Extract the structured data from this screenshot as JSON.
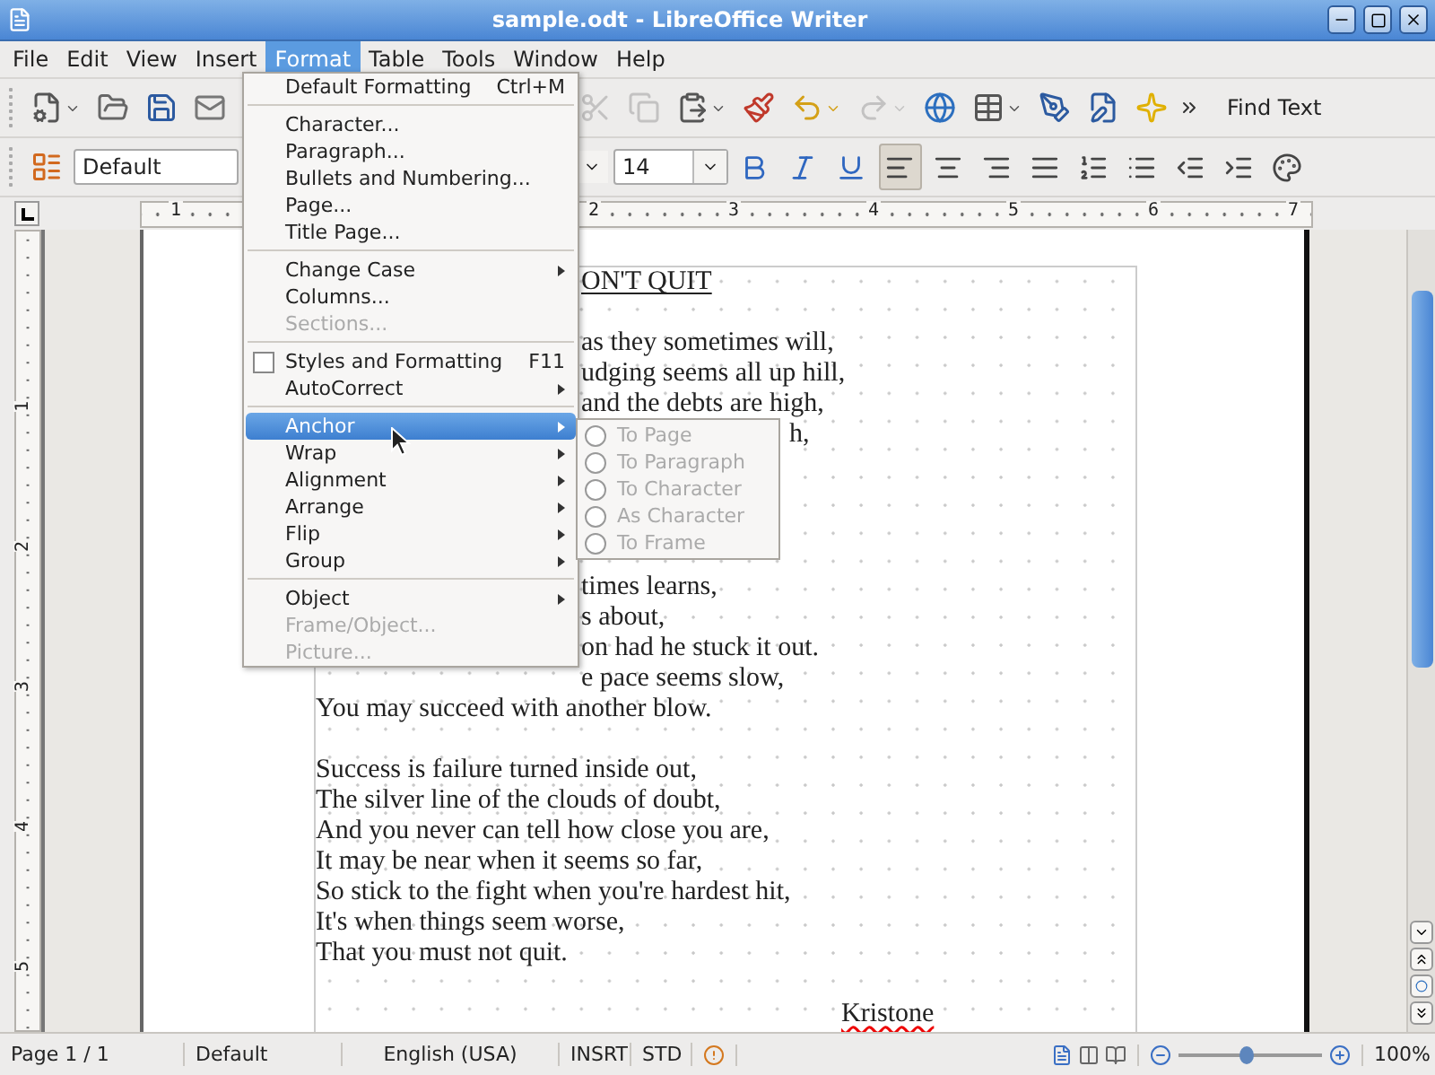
{
  "window": {
    "title": "sample.odt - LibreOffice Writer"
  },
  "menu_bar": [
    {
      "label": "File",
      "selected": false
    },
    {
      "label": "Edit",
      "selected": false
    },
    {
      "label": "View",
      "selected": false
    },
    {
      "label": "Insert",
      "selected": false
    },
    {
      "label": "Format",
      "selected": true
    },
    {
      "label": "Table",
      "selected": false
    },
    {
      "label": "Tools",
      "selected": false
    },
    {
      "label": "Window",
      "selected": false
    },
    {
      "label": "Help",
      "selected": false
    }
  ],
  "toolbar_standard": {
    "buttons": [
      {
        "dropdown": true,
        "disabled": false
      },
      {
        "dropdown": false,
        "disabled": false
      },
      {
        "dropdown": false,
        "disabled": false
      },
      {
        "dropdown": false,
        "disabled": false
      },
      {
        "dropdown": false,
        "disabled": true
      },
      {
        "dropdown": false,
        "disabled": true
      },
      {
        "dropdown": true,
        "disabled": false
      },
      {
        "dropdown": false,
        "disabled": false
      },
      {
        "dropdown": true,
        "disabled": false
      },
      {
        "dropdown": true,
        "disabled": true
      },
      {
        "dropdown": false,
        "disabled": false
      },
      {
        "dropdown": true,
        "disabled": false
      },
      {
        "dropdown": false,
        "disabled": false
      },
      {
        "dropdown": false,
        "disabled": false
      },
      {
        "dropdown": false,
        "disabled": false
      }
    ],
    "find_text": "Find Text"
  },
  "toolbar_formatting": {
    "paragraph_style": "Default",
    "font_size": "14",
    "buttons": [
      {
        "selected": false
      },
      {
        "selected": false
      },
      {
        "selected": false
      },
      {
        "selected": true
      },
      {
        "selected": false
      },
      {
        "selected": false
      },
      {
        "selected": false
      },
      {
        "selected": false
      },
      {
        "selected": false
      },
      {
        "selected": false
      },
      {
        "selected": false
      },
      {
        "selected": false
      }
    ]
  },
  "ruler": {
    "left_marks": [
      "1"
    ],
    "marks": [
      "2",
      "3",
      "4",
      "5",
      "6",
      "7"
    ]
  },
  "vertical_ruler": {
    "marks": [
      "1",
      "2",
      "3",
      "4",
      "5"
    ]
  },
  "document": {
    "stanzas": [
      {
        "kind": "title",
        "lines": [
          {
            "text": "ON'T QUIT",
            "clipped": true,
            "beside_submenu": false
          }
        ]
      },
      {
        "kind": "verse",
        "lines": [
          {
            "text": "as they sometimes will,",
            "clipped": true,
            "beside_submenu": false
          },
          {
            "text": "udging seems all up hill,",
            "clipped": true,
            "beside_submenu": false
          },
          {
            "text": "and the debts are high,",
            "clipped": true,
            "beside_submenu": false
          },
          {
            "text": "h,",
            "clipped": true,
            "beside_submenu": true
          },
          {
            "text": "times learns,",
            "clipped": true,
            "beside_submenu": false
          },
          {
            "text": "s about,",
            "clipped": true,
            "beside_submenu": false
          },
          {
            "text": "on had he stuck it out.",
            "clipped": true,
            "beside_submenu": false
          },
          {
            "text": "e pace seems slow,",
            "clipped": true,
            "beside_submenu": false
          },
          {
            "text": "You may succeed with another blow.",
            "clipped": false,
            "beside_submenu": false
          }
        ]
      },
      {
        "kind": "verse",
        "lines": [
          {
            "text": "Success is failure turned inside out,",
            "clipped": false,
            "beside_submenu": false
          },
          {
            "text": "The silver line of the clouds of doubt,",
            "clipped": false,
            "beside_submenu": false
          },
          {
            "text": "And you never can tell how close you are,",
            "clipped": false,
            "beside_submenu": false
          },
          {
            "text": "It may be near when it seems so far,",
            "clipped": false,
            "beside_submenu": false
          },
          {
            "text": "So stick to the fight when you're hardest hit,",
            "clipped": false,
            "beside_submenu": false
          },
          {
            "text": "It's when things seem worse,",
            "clipped": false,
            "beside_submenu": false
          },
          {
            "text": "That you must not quit.",
            "clipped": false,
            "beside_submenu": false
          }
        ]
      },
      {
        "kind": "signature",
        "lines": [
          {
            "text": "Kristone",
            "misspelled": true
          }
        ]
      }
    ]
  },
  "format_menu": {
    "items": [
      {
        "kind": "item",
        "label": "Default Formatting",
        "shortcut": "Ctrl+M",
        "disabled": false,
        "submenu": false,
        "selected": false
      },
      {
        "kind": "separator"
      },
      {
        "kind": "item",
        "label": "Character...",
        "disabled": false,
        "submenu": false,
        "selected": false
      },
      {
        "kind": "item",
        "label": "Paragraph...",
        "disabled": false,
        "submenu": false,
        "selected": false
      },
      {
        "kind": "item",
        "label": "Bullets and Numbering...",
        "disabled": false,
        "submenu": false,
        "selected": false
      },
      {
        "kind": "item",
        "label": "Page...",
        "disabled": false,
        "submenu": false,
        "selected": false
      },
      {
        "kind": "item",
        "label": "Title Page...",
        "disabled": false,
        "submenu": false,
        "selected": false
      },
      {
        "kind": "separator"
      },
      {
        "kind": "item",
        "label": "Change Case",
        "disabled": false,
        "submenu": true,
        "selected": false
      },
      {
        "kind": "item",
        "label": "Columns...",
        "disabled": false,
        "submenu": false,
        "selected": false
      },
      {
        "kind": "item",
        "label": "Sections...",
        "disabled": true,
        "submenu": false,
        "selected": false
      },
      {
        "kind": "separator"
      },
      {
        "kind": "check",
        "label": "Styles and Formatting",
        "shortcut": "F11",
        "checked": false,
        "disabled": false,
        "submenu": false,
        "selected": false
      },
      {
        "kind": "item",
        "label": "AutoCorrect",
        "disabled": false,
        "submenu": true,
        "selected": false
      },
      {
        "kind": "separator"
      },
      {
        "kind": "item",
        "label": "Anchor",
        "disabled": false,
        "submenu": true,
        "selected": true
      },
      {
        "kind": "item",
        "label": "Wrap",
        "disabled": false,
        "submenu": true,
        "selected": false
      },
      {
        "kind": "item",
        "label": "Alignment",
        "disabled": false,
        "submenu": true,
        "selected": false
      },
      {
        "kind": "item",
        "label": "Arrange",
        "disabled": false,
        "submenu": true,
        "selected": false
      },
      {
        "kind": "item",
        "label": "Flip",
        "disabled": false,
        "submenu": true,
        "selected": false
      },
      {
        "kind": "item",
        "label": "Group",
        "disabled": false,
        "submenu": true,
        "selected": false
      },
      {
        "kind": "separator"
      },
      {
        "kind": "item",
        "label": "Object",
        "disabled": false,
        "submenu": true,
        "selected": false
      },
      {
        "kind": "item",
        "label": "Frame/Object...",
        "disabled": true,
        "submenu": false,
        "selected": false
      },
      {
        "kind": "item",
        "label": "Picture...",
        "disabled": true,
        "submenu": false,
        "selected": false
      }
    ]
  },
  "anchor_submenu": {
    "items": [
      {
        "label": "To Page",
        "checked": false,
        "disabled": true
      },
      {
        "label": "To Paragraph",
        "checked": false,
        "disabled": true
      },
      {
        "label": "To Character",
        "checked": false,
        "disabled": true
      },
      {
        "label": "As Character",
        "checked": false,
        "disabled": true
      },
      {
        "label": "To Frame",
        "checked": false,
        "disabled": true
      }
    ]
  },
  "status_bar": {
    "page": "Page 1 / 1",
    "style": "Default",
    "language": "English (USA)",
    "insert_mode": "INSRT",
    "selection_mode": "STD",
    "zoom": {
      "level": 0.48
    },
    "zoom_percent": "100%"
  }
}
